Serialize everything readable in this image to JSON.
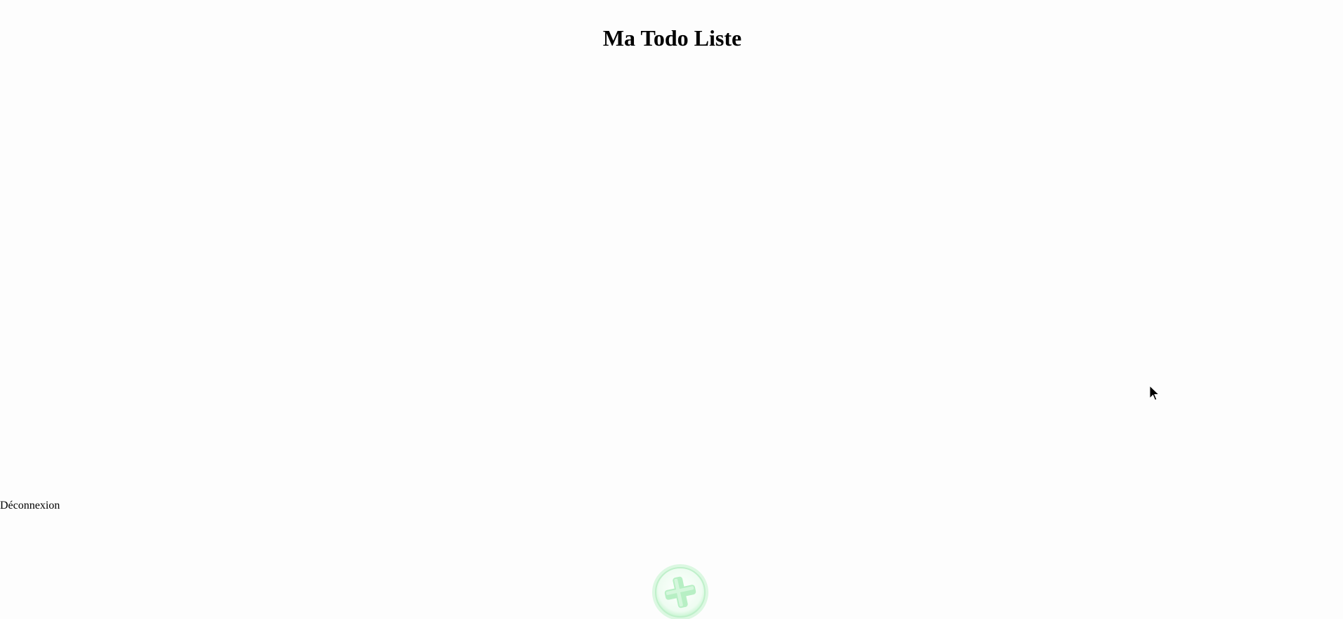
{
  "header": {
    "title": "Ma Todo Liste"
  },
  "actions": {
    "logout_label": "Déconnexion",
    "add_icon": "plus-circle-icon"
  },
  "colors": {
    "background": "#fdfdfd",
    "text": "#000000",
    "add_button_ring": "#c8f5d2",
    "add_button_plus": "#b8f0c6"
  }
}
